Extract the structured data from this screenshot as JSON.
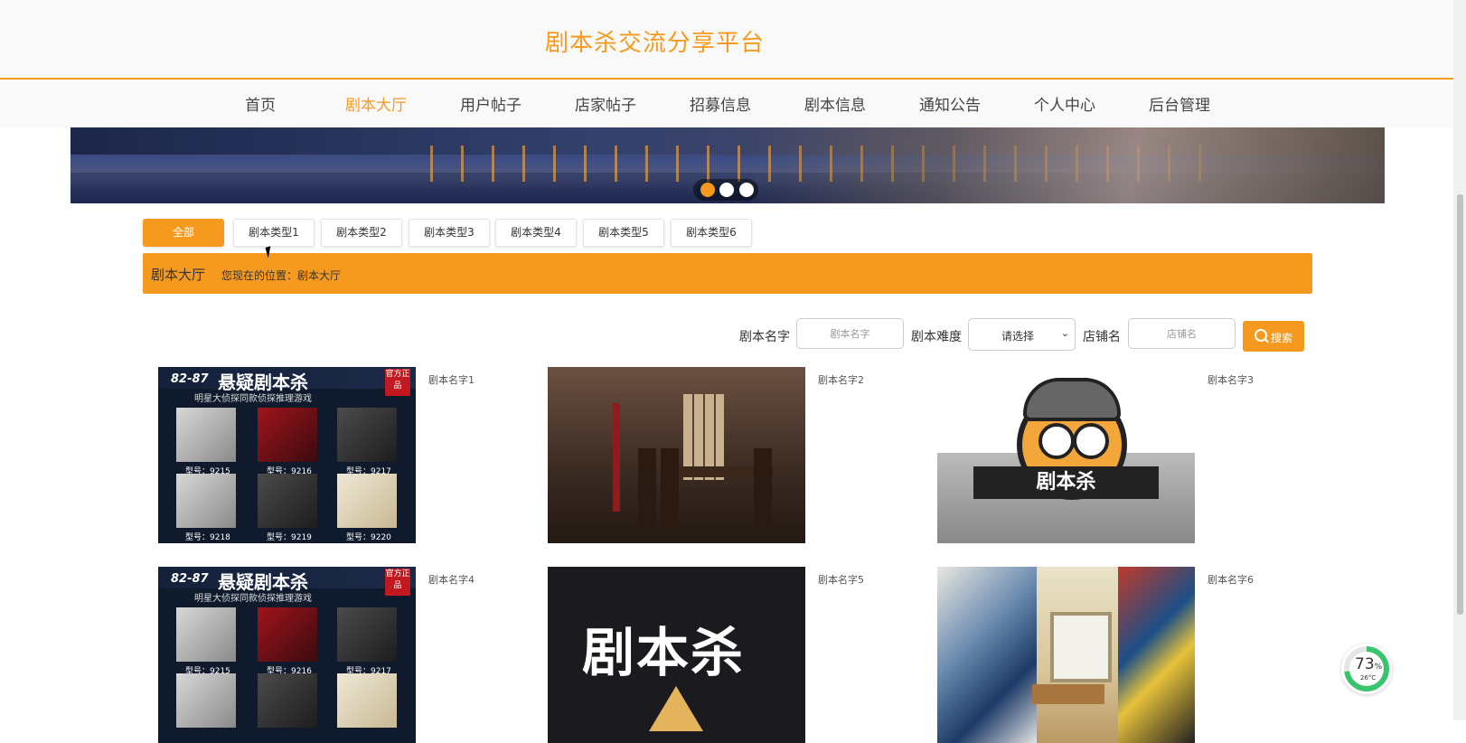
{
  "header": {
    "site_title": "剧本杀交流分享平台"
  },
  "nav": {
    "items": [
      {
        "label": "首页",
        "active": false
      },
      {
        "label": "剧本大厅",
        "active": true
      },
      {
        "label": "用户帖子",
        "active": false
      },
      {
        "label": "店家帖子",
        "active": false
      },
      {
        "label": "招募信息",
        "active": false
      },
      {
        "label": "剧本信息",
        "active": false
      },
      {
        "label": "通知公告",
        "active": false
      },
      {
        "label": "个人中心",
        "active": false
      },
      {
        "label": "后台管理",
        "active": false
      }
    ]
  },
  "carousel": {
    "active_index": 0,
    "count": 3
  },
  "category_tabs": {
    "active_index": 0,
    "items": [
      "全部",
      "剧本类型1",
      "剧本类型2",
      "剧本类型3",
      "剧本类型4",
      "剧本类型5",
      "剧本类型6"
    ]
  },
  "breadcrumb": {
    "title": "剧本大厅",
    "location": "您现在的位置：剧本大厅"
  },
  "filters": {
    "name_label": "剧本名字",
    "name_placeholder": "剧本名字",
    "difficulty_label": "剧本难度",
    "difficulty_value": "请选择",
    "shop_label": "店铺名",
    "shop_placeholder": "店铺名",
    "search_label": "搜索"
  },
  "poster_text": {
    "title": "悬疑剧本杀",
    "number": "82-87",
    "badge": "官方正品",
    "subtitle": "明星大侦探同款侦探推理游戏",
    "ids": [
      "型号：9215",
      "型号：9216",
      "型号：9217",
      "型号：9218",
      "型号：9219",
      "型号：9220"
    ]
  },
  "logo_text": "剧本杀",
  "scripts": [
    {
      "name": "剧本名字1",
      "image": "poster"
    },
    {
      "name": "剧本名字2",
      "image": "room"
    },
    {
      "name": "剧本名字3",
      "image": "logo"
    },
    {
      "name": "剧本名字4",
      "image": "poster"
    },
    {
      "name": "剧本名字5",
      "image": "black-logo"
    },
    {
      "name": "剧本名字6",
      "image": "tatami"
    }
  ],
  "widget": {
    "percent": "73",
    "percent_unit": "%",
    "temperature": "26°C"
  },
  "colors": {
    "accent": "#f69a1f",
    "progress": "#39c56d"
  }
}
